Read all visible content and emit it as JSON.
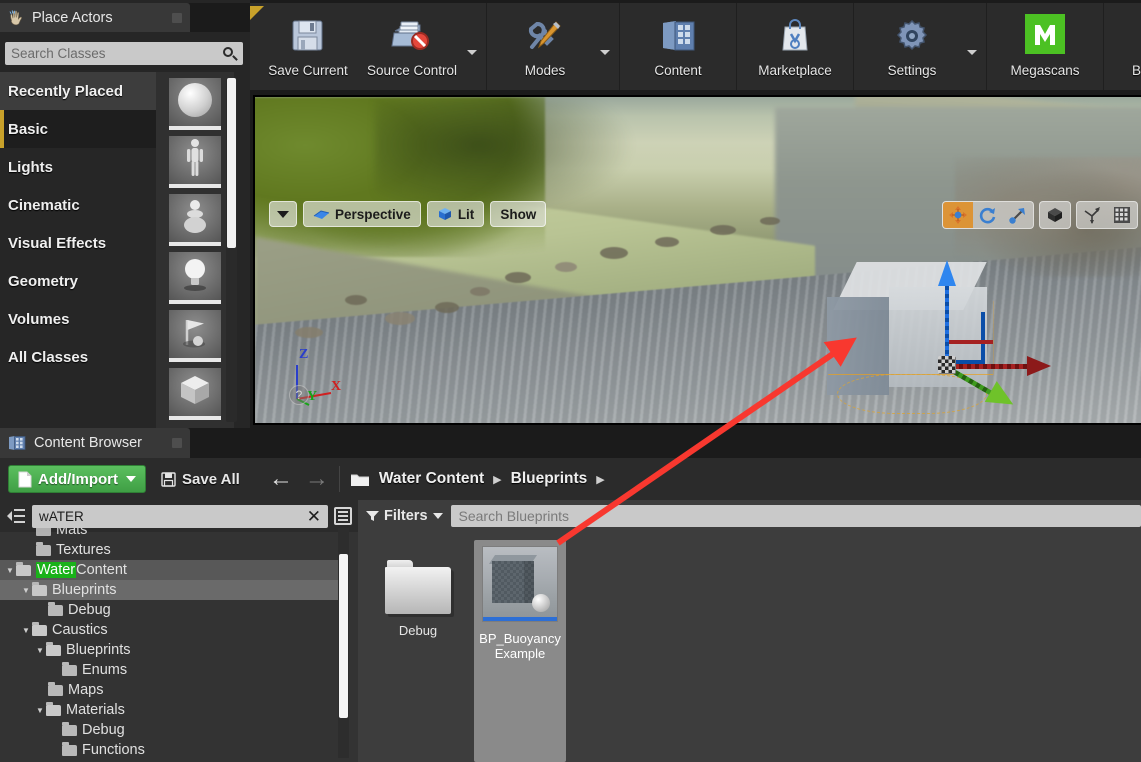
{
  "toolbar": {
    "groups": [
      {
        "buttons": [
          {
            "label": "Save Current",
            "icon": "floppy-disk-icon",
            "caret": false
          },
          {
            "label": "Source Control",
            "icon": "source-control-icon",
            "caret": true
          }
        ]
      },
      {
        "buttons": [
          {
            "label": "Modes",
            "icon": "wrench-pencil-icon",
            "caret": true
          }
        ]
      },
      {
        "buttons": [
          {
            "label": "Content",
            "icon": "content-grid-icon",
            "caret": false
          }
        ]
      },
      {
        "buttons": [
          {
            "label": "Marketplace",
            "icon": "shopping-bag-icon",
            "caret": false
          }
        ]
      },
      {
        "buttons": [
          {
            "label": "Settings",
            "icon": "gear-icon",
            "caret": true
          }
        ]
      },
      {
        "buttons": [
          {
            "label": "Megascans",
            "icon": "megascans-m-icon",
            "caret": false
          }
        ]
      },
      {
        "buttons": [
          {
            "label": "Blueprints",
            "icon": "blueprints-gamepad-icon",
            "caret": true
          }
        ]
      }
    ]
  },
  "place_actors": {
    "tab_title": "Place Actors",
    "search_placeholder": "Search Classes",
    "categories": [
      {
        "label": "Recently Placed",
        "selected": false,
        "first": true
      },
      {
        "label": "Basic",
        "selected": true
      },
      {
        "label": "Lights",
        "selected": false
      },
      {
        "label": "Cinematic",
        "selected": false
      },
      {
        "label": "Visual Effects",
        "selected": false
      },
      {
        "label": "Geometry",
        "selected": false
      },
      {
        "label": "Volumes",
        "selected": false
      },
      {
        "label": "All Classes",
        "selected": false
      }
    ],
    "asset_thumbs": [
      "sphere-thumb",
      "mannequin-thumb",
      "pawn-thumb",
      "light-bulb-thumb",
      "player-start-thumb",
      "cube-thumb"
    ]
  },
  "viewport": {
    "view_mode_caret": "viewport-options-caret",
    "perspective_label": "Perspective",
    "lit_label": "Lit",
    "show_label": "Show",
    "axis_labels": {
      "z": "Z",
      "y": "Y",
      "x": "X"
    },
    "help_label": "?",
    "transform_tools": [
      {
        "name": "translate-tool",
        "active": true
      },
      {
        "name": "rotate-tool",
        "active": false
      },
      {
        "name": "scale-tool",
        "active": false
      },
      {
        "name": "world-space-toggle",
        "active": false
      },
      {
        "name": "surface-snap-toggle",
        "active": false
      },
      {
        "name": "grid-snap-toggle",
        "active": false
      }
    ],
    "selection": {
      "actor": "cube-actor",
      "outline_color": "#e8a020",
      "gizmo": "translate-gizmo",
      "axis_colors": {
        "x": "#8c1a1a",
        "y": "#6fc22a",
        "z": "#2f86ef"
      }
    }
  },
  "content_browser": {
    "tab_title": "Content Browser",
    "add_import_label": "Add/Import",
    "save_all_label": "Save All",
    "breadcrumb": [
      {
        "label": "Water Content"
      },
      {
        "label": "Blueprints"
      }
    ],
    "tree_search_value": "wATER",
    "tree_search_highlight": "Water",
    "tree": [
      {
        "label": "Mats",
        "depth": 2,
        "twisty": "",
        "partial_top": true
      },
      {
        "label": "Textures",
        "depth": 2,
        "twisty": ""
      },
      {
        "label": "Water Content",
        "depth": 0,
        "twisty": "down",
        "selected": true,
        "highlight": "Water",
        "rest": " Content"
      },
      {
        "label": "Blueprints",
        "depth": 1,
        "twisty": "down",
        "selected2": true
      },
      {
        "label": "Debug",
        "depth": 2,
        "twisty": ""
      },
      {
        "label": "Caustics",
        "depth": 1,
        "twisty": "down"
      },
      {
        "label": "Blueprints",
        "depth": 2,
        "twisty": "down"
      },
      {
        "label": "Enums",
        "depth": 3,
        "twisty": ""
      },
      {
        "label": "Maps",
        "depth": 2,
        "twisty": ""
      },
      {
        "label": "Materials",
        "depth": 2,
        "twisty": "down"
      },
      {
        "label": "Debug",
        "depth": 3,
        "twisty": ""
      },
      {
        "label": "Functions",
        "depth": 3,
        "twisty": ""
      }
    ],
    "filters_label": "Filters",
    "asset_search_placeholder": "Search Blueprints",
    "assets": [
      {
        "name": "Debug",
        "type": "folder",
        "selected": false
      },
      {
        "name": "BP_Buoyancy\nExample",
        "type": "blueprint",
        "selected": true
      }
    ],
    "asset_names": {
      "folder_debug": "Debug",
      "bp_buoyancy": "BP_Buoyancy Example",
      "bp_buoyancy_line1": "BP_Buoyancy",
      "bp_buoyancy_line2": "Example"
    }
  },
  "annotation": {
    "arrow_color": "#f8382f",
    "description": "red-arrow-pointing-from-asset-to-viewport-cube"
  },
  "colors": {
    "accent_green": "#3f9f45",
    "selection_orange": "#e8a020",
    "panel_bg": "#262626",
    "toolbar_bg": "#2b2b2b",
    "highlight_green": "#19b219"
  }
}
